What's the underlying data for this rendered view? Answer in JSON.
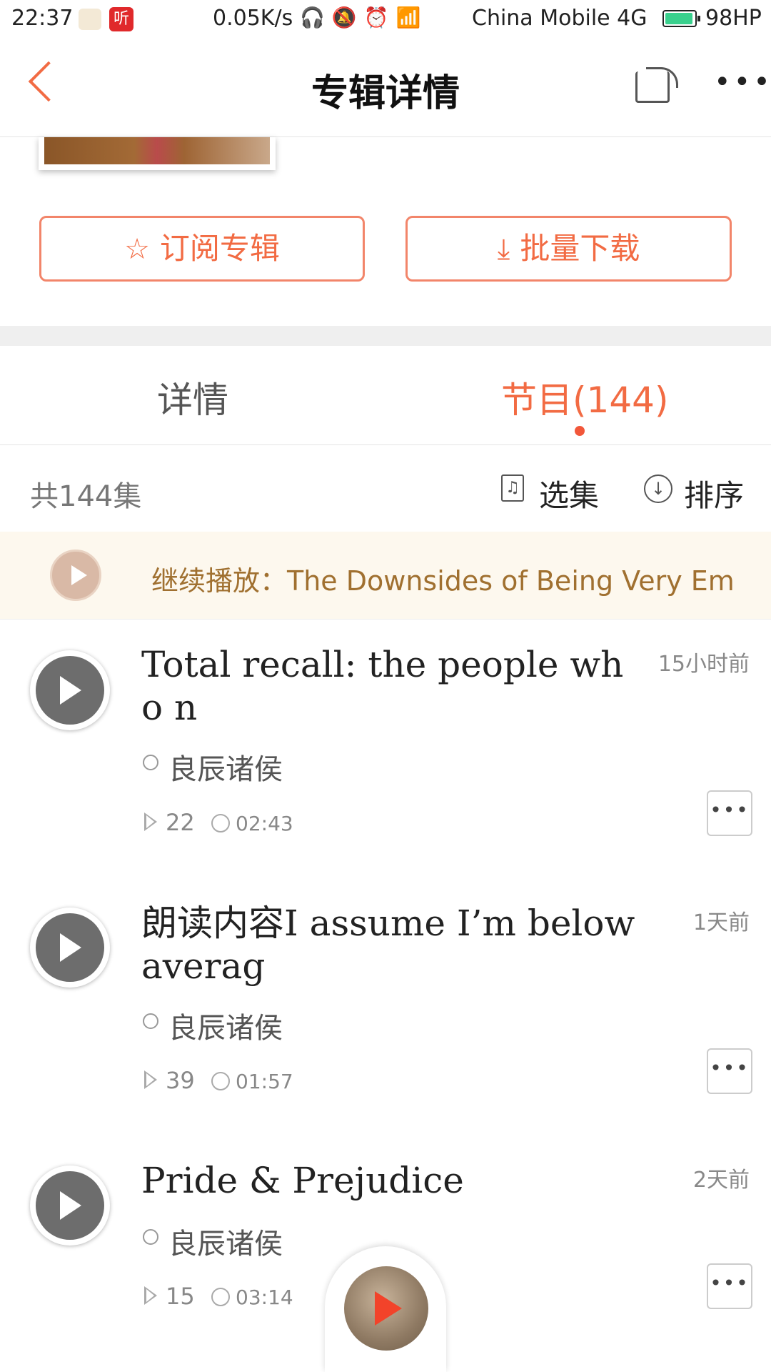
{
  "status_bar": {
    "time": "22:37",
    "app_badge": "听",
    "speed": "0.05K/s",
    "icons": "headset mute alarm wifi signal",
    "carrier": "China Mobile 4G",
    "battery": "98HP",
    "battery_color": "#39d08d"
  },
  "nav": {
    "title": "专辑详情",
    "back_icon": "chevron-left-icon",
    "share_icon": "share-icon",
    "more_icon": "more-horizontal-icon"
  },
  "actions": {
    "subscribe": "订阅专辑",
    "batch_download": "批量下载"
  },
  "tabs": [
    {
      "label": "详情"
    },
    {
      "label": "节目(144)"
    }
  ],
  "toolbar": {
    "count": "共144集",
    "select": "选集",
    "sort": "排序"
  },
  "continue": {
    "text": "继续播放：The Downsides of Being Very Em"
  },
  "episodes": [
    {
      "title": "Total recall: the people who n",
      "time": "15小时前",
      "author": "良辰诸侯",
      "plays": "22",
      "duration": "02:43"
    },
    {
      "title": "朗读内容I assume I’m below averag",
      "time": "1天前",
      "author": "良辰诸侯",
      "plays": "39",
      "duration": "01:57"
    },
    {
      "title": "Pride & Prejudice",
      "time": "2天前",
      "author": "良辰诸侯",
      "plays": "15",
      "duration": "03:14"
    }
  ],
  "colors": {
    "accent": "#f26b43",
    "continue_bg": "#fdf8ee",
    "continue_text": "#a07030"
  }
}
